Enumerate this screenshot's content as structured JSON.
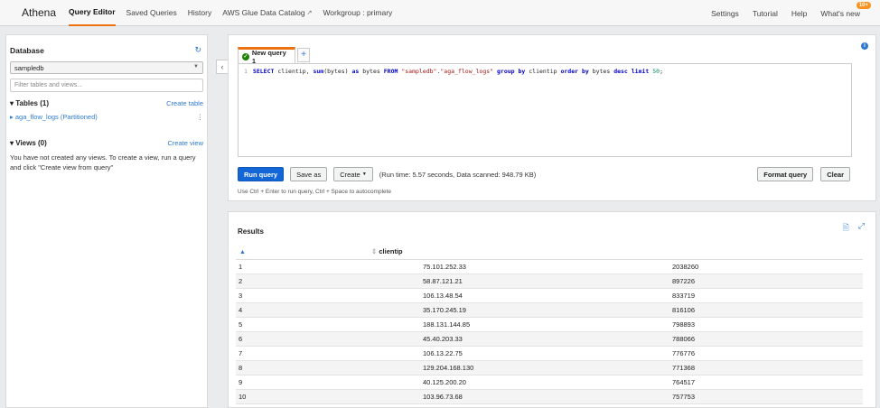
{
  "nav": {
    "brand": "Athena",
    "items": [
      "Query Editor",
      "Saved Queries",
      "History",
      "AWS Glue Data Catalog",
      "Workgroup : primary"
    ],
    "right_items": [
      "Settings",
      "Tutorial",
      "Help",
      "What's new"
    ],
    "badge": "10+"
  },
  "sidebar": {
    "title": "Database",
    "database_selected": "sampledb",
    "filter_placeholder": "Filter tables and views...",
    "tables_heading": "Tables (1)",
    "create_table": "Create table",
    "table_item": "aga_flow_logs (Partitioned)",
    "views_heading": "Views (0)",
    "create_view": "Create view",
    "views_message": "You have not created any views. To create a view, run a query and click \"Create view from query\""
  },
  "editor": {
    "tab_label": "New query 1",
    "line_number": "1",
    "query": {
      "k1": "SELECT",
      "t1": " clientip, ",
      "k2": "sum",
      "t2": "(bytes) ",
      "k3": "as",
      "t3": " bytes ",
      "k4": "FROM",
      "t4": " ",
      "s1": "\"sampledb\"",
      "t5": ".",
      "s2": "\"aga_flow_logs\"",
      "t6": " ",
      "k5": "group by",
      "t7": " clientip ",
      "k6": "order by",
      "t8": " bytes ",
      "k7": "desc",
      "t9": " ",
      "k8": "limit",
      "t10": " ",
      "n1": "50",
      "t11": ";"
    },
    "run_button": "Run query",
    "save_button": "Save as",
    "create_button": "Create",
    "run_info": "(Run time: 5.57 seconds, Data scanned: 948.79 KB)",
    "format_button": "Format query",
    "clear_button": "Clear",
    "hint": "Use Ctrl + Enter to run query, Ctrl + Space to autocomplete"
  },
  "results": {
    "title": "Results",
    "col_clientip": "clientip",
    "rows": [
      [
        "1",
        "75.101.252.33",
        "2038260"
      ],
      [
        "2",
        "58.87.121.21",
        "897226"
      ],
      [
        "3",
        "106.13.48.54",
        "833719"
      ],
      [
        "4",
        "35.170.245.19",
        "816106"
      ],
      [
        "5",
        "188.131.144.85",
        "798893"
      ],
      [
        "6",
        "45.40.203.33",
        "788066"
      ],
      [
        "7",
        "106.13.22.75",
        "776776"
      ],
      [
        "8",
        "129.204.168.130",
        "771368"
      ],
      [
        "9",
        "40.125.200.20",
        "764517"
      ],
      [
        "10",
        "103.96.73.68",
        "757753"
      ]
    ]
  }
}
